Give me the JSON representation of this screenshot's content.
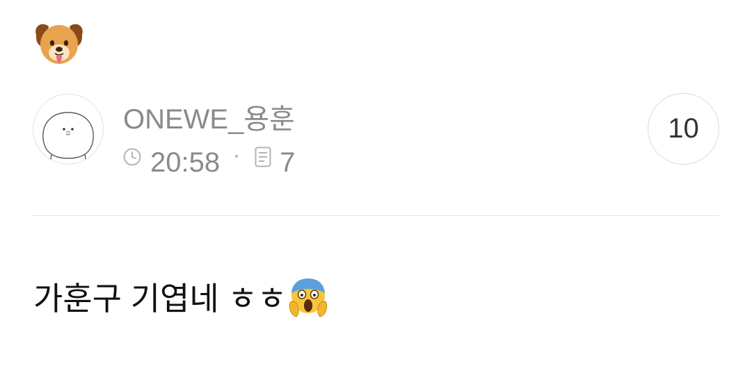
{
  "comment_block": {
    "top_emoji_icon": "dog-face-icon",
    "author": {
      "name": "ONEWE_용훈",
      "avatar_icon": "seal-character-avatar"
    },
    "meta": {
      "clock_icon": "clock-icon",
      "time": "20:58",
      "doc_icon": "document-icon",
      "count": "7"
    },
    "reply_count": "10",
    "body_text": "가훈구 기엽네 ㅎㅎ",
    "body_emoji_icon": "face-screaming-in-fear-icon"
  },
  "colors": {
    "meta_text": "#8a8a8a",
    "body_text": "#111111",
    "divider": "#e6e6e6",
    "badge_border": "#dadada"
  }
}
